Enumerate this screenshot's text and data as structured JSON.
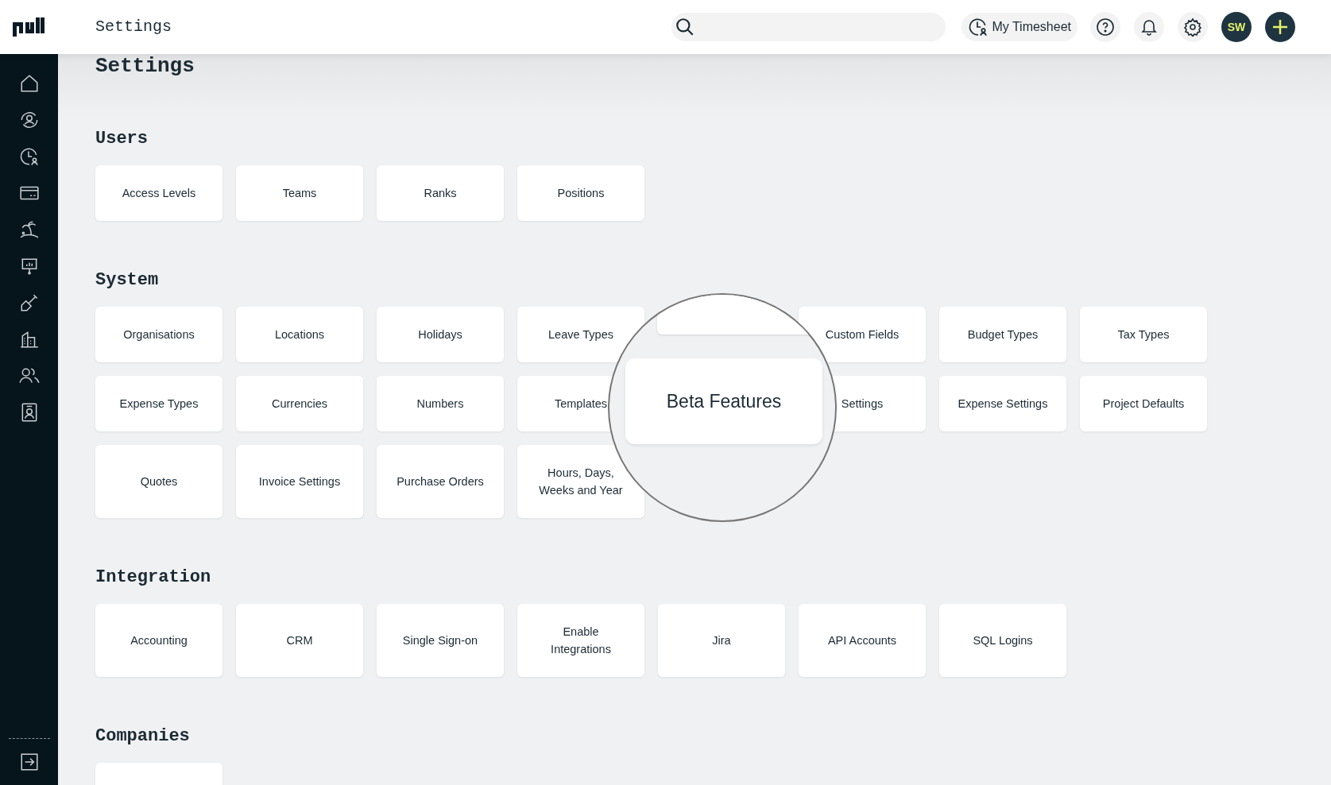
{
  "topbar": {
    "title": "Settings",
    "timesheet_button": "My Timesheet",
    "avatar": "SW"
  },
  "page_title": "Settings",
  "sections": [
    {
      "title": "Users",
      "items": [
        {
          "kind": "card",
          "label": "Access Levels"
        },
        {
          "kind": "card",
          "label": "Teams"
        },
        {
          "kind": "card",
          "label": "Ranks"
        },
        {
          "kind": "card",
          "label": "Positions"
        }
      ]
    },
    {
      "title": "System",
      "items": [
        {
          "kind": "card",
          "label": "Organisations"
        },
        {
          "kind": "card",
          "label": "Locations"
        },
        {
          "kind": "card",
          "label": "Holidays"
        },
        {
          "kind": "card",
          "label": "Leave Types"
        },
        {
          "kind": "covered"
        },
        {
          "kind": "card",
          "label": "Custom Fields"
        },
        {
          "kind": "card",
          "label": "Budget Types"
        },
        {
          "kind": "card",
          "label": "Tax Types"
        },
        {
          "kind": "card",
          "label": "Expense Types"
        },
        {
          "kind": "card",
          "label": "Currencies"
        },
        {
          "kind": "card",
          "label": "Numbers"
        },
        {
          "kind": "card",
          "label": "Templates"
        },
        {
          "kind": "covered"
        },
        {
          "kind": "card",
          "label": "Settings"
        },
        {
          "kind": "card",
          "label": "Expense Settings"
        },
        {
          "kind": "card",
          "label": "Project Defaults"
        },
        {
          "kind": "card",
          "label": "Quotes"
        },
        {
          "kind": "card",
          "label": "Invoice Settings"
        },
        {
          "kind": "card",
          "label": "Purchase Orders"
        },
        {
          "kind": "card",
          "label": "Hours, Days, Weeks and Year"
        }
      ]
    },
    {
      "title": "Integration",
      "items": [
        {
          "kind": "card",
          "label": "Accounting"
        },
        {
          "kind": "card",
          "label": "CRM"
        },
        {
          "kind": "card",
          "label": "Single Sign-on"
        },
        {
          "kind": "card",
          "label": "Enable Integrations"
        },
        {
          "kind": "card",
          "label": "Jira"
        },
        {
          "kind": "card",
          "label": "API Accounts"
        },
        {
          "kind": "card",
          "label": "SQL Logins"
        }
      ]
    },
    {
      "title": "Companies",
      "items": [
        {
          "kind": "blank"
        }
      ]
    }
  ],
  "magnifier": {
    "label": "Beta Features"
  }
}
